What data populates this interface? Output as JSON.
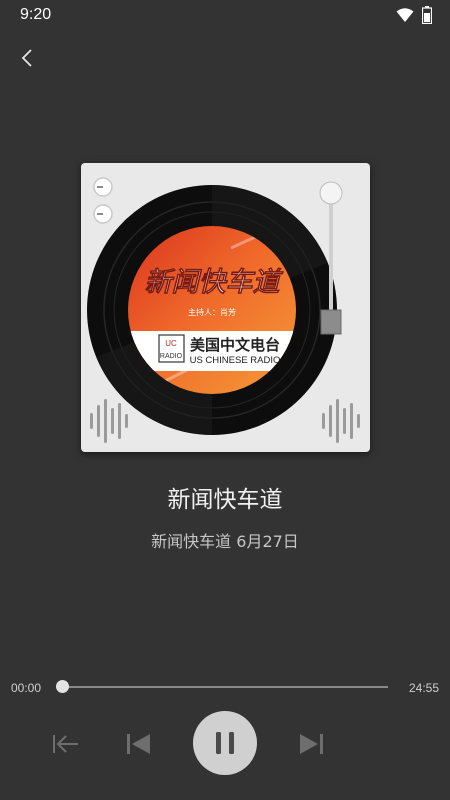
{
  "status_bar": {
    "time": "9:20",
    "wifi_icon": "wifi-icon",
    "battery_icon": "battery-icon"
  },
  "nav": {
    "back_icon": "chevron-left-icon"
  },
  "cover": {
    "headline": "新闻快车道",
    "host": "主持人：肖芳",
    "station_name": "美国中文电台",
    "station_english": "US CHINESE RADIO",
    "logo_lines": [
      "UC",
      "RADIO"
    ]
  },
  "track": {
    "title": "新闻快车道",
    "subtitle": "新闻快车道 6月27日"
  },
  "player": {
    "current_time": "00:00",
    "duration": "24:55",
    "progress": 0.0,
    "controls": [
      "skip-to-start-icon",
      "previous-icon",
      "pause-icon",
      "next-icon"
    ]
  },
  "colors": {
    "background": "#333333",
    "accent": "#d0d0d0"
  }
}
